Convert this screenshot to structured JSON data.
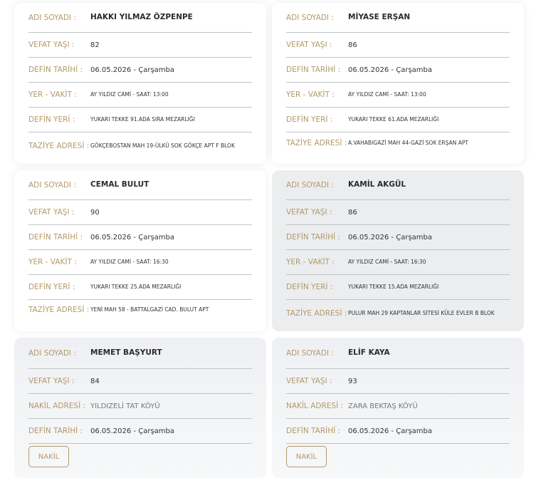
{
  "cards": [
    {
      "rows": [
        {
          "label": "ADI SOYADI :",
          "value": "HAKKI YILMAZ ÖZPENPE"
        },
        {
          "label": "VEFAT YAŞI :",
          "value": "82"
        },
        {
          "label": "DEFİN TARİHİ :",
          "value": "06.05.2026 - Çarşamba"
        },
        {
          "label": "YER - VAKİT :",
          "value": "AY YILDIZ CAMİ - SAAT: 13:00"
        },
        {
          "label": "DEFİN YERİ :",
          "value": "YUKARI TEKKE 91.ADA SIRA MEZARLIĞI"
        },
        {
          "label": "TAZİYE ADRESİ :",
          "value": "GÖKÇEBOSTAN MAH 19-ÜLKÜ SOK GÖKÇE APT F BLOK"
        }
      ]
    },
    {
      "rows": [
        {
          "label": "ADI SOYADI :",
          "value": "MİYASE ERŞAN"
        },
        {
          "label": "VEFAT YAŞI :",
          "value": "86"
        },
        {
          "label": "DEFİN TARİHİ :",
          "value": "06.05.2026 - Çarşamba"
        },
        {
          "label": "YER - VAKİT :",
          "value": "AY YILDIZ CAMİ - SAAT: 13:00"
        },
        {
          "label": "DEFİN YERİ :",
          "value": "YUKARI TEKKE 61.ADA MEZARLIĞI"
        },
        {
          "label": "TAZİYE ADRESİ :",
          "value": "A.VAHABIGAZİ MAH 44-GAZİ SOK ERŞAN APT"
        }
      ]
    },
    {
      "rows": [
        {
          "label": "ADI SOYADI :",
          "value": "CEMAL BULUT"
        },
        {
          "label": "VEFAT YAŞI :",
          "value": "90"
        },
        {
          "label": "DEFİN TARİHİ :",
          "value": "06.05.2026 - Çarşamba"
        },
        {
          "label": "YER - VAKİT :",
          "value": "AY YILDIZ CAMİ - SAAT: 16:30"
        },
        {
          "label": "DEFİN YERİ :",
          "value": "YUKARI TEKKE 25.ADA MEZARLIĞI"
        },
        {
          "label": "TAZİYE ADRESİ :",
          "value": "YENİ MAH 58 - BATTALGAZİ CAD. BULUT APT"
        }
      ]
    },
    {
      "rows": [
        {
          "label": "ADI SOYADI :",
          "value": "KAMİL AKGÜL"
        },
        {
          "label": "VEFAT YAŞI :",
          "value": "86"
        },
        {
          "label": "DEFİN TARİHİ :",
          "value": "06.05.2026 - Çarşamba"
        },
        {
          "label": "YER - VAKİT :",
          "value": "AY YILDIZ CAMİ - SAAT: 16:30"
        },
        {
          "label": "DEFİN YERİ :",
          "value": "YUKARI TEKKE 15.ADA MEZARLIĞI"
        },
        {
          "label": "TAZİYE ADRESİ :",
          "value": "PULUR MAH 29 KAPTANLAR SİTESİ KÜLE EVLER B BLOK"
        }
      ]
    },
    {
      "rows": [
        {
          "label": "ADI SOYADI :",
          "value": "MEMET BAŞYURT"
        },
        {
          "label": "VEFAT YAŞI :",
          "value": "84"
        },
        {
          "label": "NAKİL ADRESİ :",
          "value": "YILDIZELİ TAT KÖYÜ"
        },
        {
          "label": "DEFİN TARİHİ :",
          "value": "06.05.2026 - Çarşamba"
        }
      ],
      "button": "NAKİL"
    },
    {
      "rows": [
        {
          "label": "ADI SOYADI :",
          "value": "ELİF KAYA"
        },
        {
          "label": "VEFAT YAŞI :",
          "value": "93"
        },
        {
          "label": "NAKİL ADRESİ :",
          "value": "ZARA BEKTAŞ KÖYÜ"
        },
        {
          "label": "DEFİN TARİHİ :",
          "value": "06.05.2026 - Çarşamba"
        }
      ],
      "button": "NAKİL"
    }
  ]
}
